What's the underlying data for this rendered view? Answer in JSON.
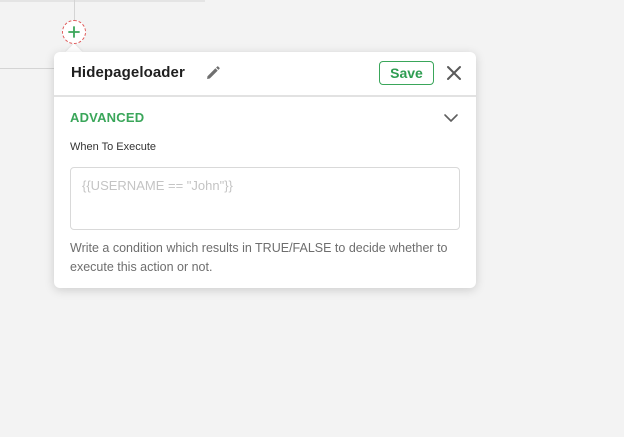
{
  "canvas": {
    "add_node_icon": "plus-icon"
  },
  "popover": {
    "title": "Hidepageloader",
    "edit_icon": "pencil-icon",
    "save_label": "Save",
    "close_icon": "close-icon",
    "section": {
      "title": "ADVANCED",
      "toggle_icon": "chevron-down-icon"
    },
    "when_to_execute": {
      "label": "When To Execute",
      "value": "",
      "placeholder": "{{USERNAME == \"John\"}}",
      "help": "Write a condition which results in TRUE/FALSE to decide whether to execute this action or not."
    }
  },
  "colors": {
    "accent_green": "#3aa65a",
    "add_node_border": "#e05a5a",
    "background": "#f3f3f3"
  }
}
